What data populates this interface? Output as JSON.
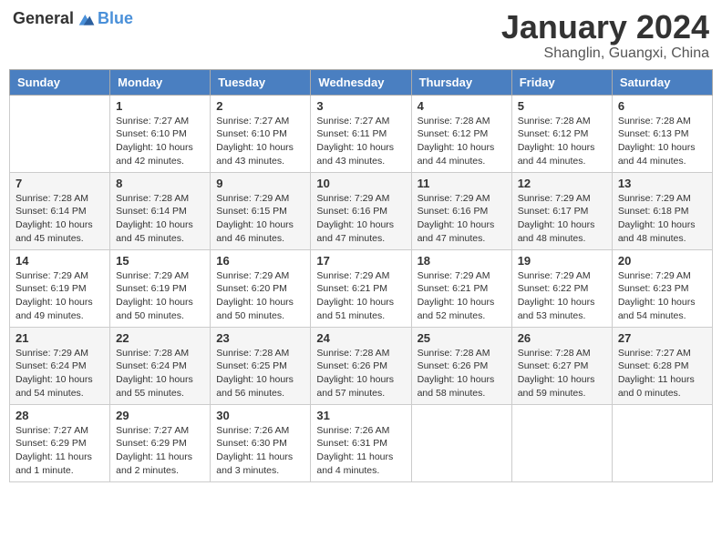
{
  "header": {
    "logo_general": "General",
    "logo_blue": "Blue",
    "month": "January 2024",
    "location": "Shanglin, Guangxi, China"
  },
  "weekdays": [
    "Sunday",
    "Monday",
    "Tuesday",
    "Wednesday",
    "Thursday",
    "Friday",
    "Saturday"
  ],
  "weeks": [
    [
      {
        "day": "",
        "sunrise": "",
        "sunset": "",
        "daylight": ""
      },
      {
        "day": "1",
        "sunrise": "Sunrise: 7:27 AM",
        "sunset": "Sunset: 6:10 PM",
        "daylight": "Daylight: 10 hours and 42 minutes."
      },
      {
        "day": "2",
        "sunrise": "Sunrise: 7:27 AM",
        "sunset": "Sunset: 6:10 PM",
        "daylight": "Daylight: 10 hours and 43 minutes."
      },
      {
        "day": "3",
        "sunrise": "Sunrise: 7:27 AM",
        "sunset": "Sunset: 6:11 PM",
        "daylight": "Daylight: 10 hours and 43 minutes."
      },
      {
        "day": "4",
        "sunrise": "Sunrise: 7:28 AM",
        "sunset": "Sunset: 6:12 PM",
        "daylight": "Daylight: 10 hours and 44 minutes."
      },
      {
        "day": "5",
        "sunrise": "Sunrise: 7:28 AM",
        "sunset": "Sunset: 6:12 PM",
        "daylight": "Daylight: 10 hours and 44 minutes."
      },
      {
        "day": "6",
        "sunrise": "Sunrise: 7:28 AM",
        "sunset": "Sunset: 6:13 PM",
        "daylight": "Daylight: 10 hours and 44 minutes."
      }
    ],
    [
      {
        "day": "7",
        "sunrise": "Sunrise: 7:28 AM",
        "sunset": "Sunset: 6:14 PM",
        "daylight": "Daylight: 10 hours and 45 minutes."
      },
      {
        "day": "8",
        "sunrise": "Sunrise: 7:28 AM",
        "sunset": "Sunset: 6:14 PM",
        "daylight": "Daylight: 10 hours and 45 minutes."
      },
      {
        "day": "9",
        "sunrise": "Sunrise: 7:29 AM",
        "sunset": "Sunset: 6:15 PM",
        "daylight": "Daylight: 10 hours and 46 minutes."
      },
      {
        "day": "10",
        "sunrise": "Sunrise: 7:29 AM",
        "sunset": "Sunset: 6:16 PM",
        "daylight": "Daylight: 10 hours and 47 minutes."
      },
      {
        "day": "11",
        "sunrise": "Sunrise: 7:29 AM",
        "sunset": "Sunset: 6:16 PM",
        "daylight": "Daylight: 10 hours and 47 minutes."
      },
      {
        "day": "12",
        "sunrise": "Sunrise: 7:29 AM",
        "sunset": "Sunset: 6:17 PM",
        "daylight": "Daylight: 10 hours and 48 minutes."
      },
      {
        "day": "13",
        "sunrise": "Sunrise: 7:29 AM",
        "sunset": "Sunset: 6:18 PM",
        "daylight": "Daylight: 10 hours and 48 minutes."
      }
    ],
    [
      {
        "day": "14",
        "sunrise": "Sunrise: 7:29 AM",
        "sunset": "Sunset: 6:19 PM",
        "daylight": "Daylight: 10 hours and 49 minutes."
      },
      {
        "day": "15",
        "sunrise": "Sunrise: 7:29 AM",
        "sunset": "Sunset: 6:19 PM",
        "daylight": "Daylight: 10 hours and 50 minutes."
      },
      {
        "day": "16",
        "sunrise": "Sunrise: 7:29 AM",
        "sunset": "Sunset: 6:20 PM",
        "daylight": "Daylight: 10 hours and 50 minutes."
      },
      {
        "day": "17",
        "sunrise": "Sunrise: 7:29 AM",
        "sunset": "Sunset: 6:21 PM",
        "daylight": "Daylight: 10 hours and 51 minutes."
      },
      {
        "day": "18",
        "sunrise": "Sunrise: 7:29 AM",
        "sunset": "Sunset: 6:21 PM",
        "daylight": "Daylight: 10 hours and 52 minutes."
      },
      {
        "day": "19",
        "sunrise": "Sunrise: 7:29 AM",
        "sunset": "Sunset: 6:22 PM",
        "daylight": "Daylight: 10 hours and 53 minutes."
      },
      {
        "day": "20",
        "sunrise": "Sunrise: 7:29 AM",
        "sunset": "Sunset: 6:23 PM",
        "daylight": "Daylight: 10 hours and 54 minutes."
      }
    ],
    [
      {
        "day": "21",
        "sunrise": "Sunrise: 7:29 AM",
        "sunset": "Sunset: 6:24 PM",
        "daylight": "Daylight: 10 hours and 54 minutes."
      },
      {
        "day": "22",
        "sunrise": "Sunrise: 7:28 AM",
        "sunset": "Sunset: 6:24 PM",
        "daylight": "Daylight: 10 hours and 55 minutes."
      },
      {
        "day": "23",
        "sunrise": "Sunrise: 7:28 AM",
        "sunset": "Sunset: 6:25 PM",
        "daylight": "Daylight: 10 hours and 56 minutes."
      },
      {
        "day": "24",
        "sunrise": "Sunrise: 7:28 AM",
        "sunset": "Sunset: 6:26 PM",
        "daylight": "Daylight: 10 hours and 57 minutes."
      },
      {
        "day": "25",
        "sunrise": "Sunrise: 7:28 AM",
        "sunset": "Sunset: 6:26 PM",
        "daylight": "Daylight: 10 hours and 58 minutes."
      },
      {
        "day": "26",
        "sunrise": "Sunrise: 7:28 AM",
        "sunset": "Sunset: 6:27 PM",
        "daylight": "Daylight: 10 hours and 59 minutes."
      },
      {
        "day": "27",
        "sunrise": "Sunrise: 7:27 AM",
        "sunset": "Sunset: 6:28 PM",
        "daylight": "Daylight: 11 hours and 0 minutes."
      }
    ],
    [
      {
        "day": "28",
        "sunrise": "Sunrise: 7:27 AM",
        "sunset": "Sunset: 6:29 PM",
        "daylight": "Daylight: 11 hours and 1 minute."
      },
      {
        "day": "29",
        "sunrise": "Sunrise: 7:27 AM",
        "sunset": "Sunset: 6:29 PM",
        "daylight": "Daylight: 11 hours and 2 minutes."
      },
      {
        "day": "30",
        "sunrise": "Sunrise: 7:26 AM",
        "sunset": "Sunset: 6:30 PM",
        "daylight": "Daylight: 11 hours and 3 minutes."
      },
      {
        "day": "31",
        "sunrise": "Sunrise: 7:26 AM",
        "sunset": "Sunset: 6:31 PM",
        "daylight": "Daylight: 11 hours and 4 minutes."
      },
      {
        "day": "",
        "sunrise": "",
        "sunset": "",
        "daylight": ""
      },
      {
        "day": "",
        "sunrise": "",
        "sunset": "",
        "daylight": ""
      },
      {
        "day": "",
        "sunrise": "",
        "sunset": "",
        "daylight": ""
      }
    ]
  ]
}
